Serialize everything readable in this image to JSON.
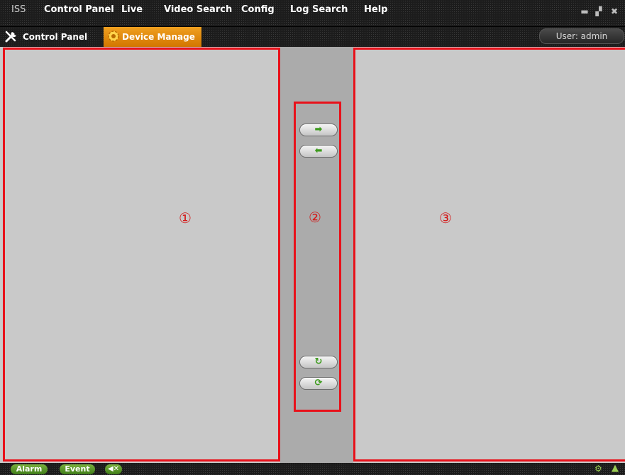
{
  "menu": {
    "brand": "ISS",
    "items": [
      "Control Panel",
      "Live",
      "Video Search",
      "Config",
      "Log Search",
      "Help"
    ]
  },
  "window_controls": {
    "minimize_icon": "minimize-icon",
    "restore_icon": "restore-icon",
    "close_icon": "close-icon"
  },
  "tabs": [
    {
      "label": "Control Panel",
      "icon": "tools-icon",
      "active": false
    },
    {
      "label": "Device Manage",
      "icon": "gear-icon",
      "active": true
    }
  ],
  "user": {
    "label": "User: admin"
  },
  "panels": {
    "left_marker": "①",
    "middle_marker": "②",
    "right_marker": "③"
  },
  "transfer_buttons": [
    {
      "icon": "arrow-right-icon",
      "glyph": "➡"
    },
    {
      "icon": "arrow-left-icon",
      "glyph": "⬅"
    },
    {
      "icon": "refresh-icon",
      "glyph": "↻"
    },
    {
      "icon": "sync-icon",
      "glyph": "⟳"
    }
  ],
  "status": {
    "alarm_label": "Alarm",
    "event_label": "Event",
    "mute_icon": "mute-icon",
    "right_icons": [
      "settings-icon",
      "up-arrow-icon"
    ]
  },
  "colors": {
    "highlight_border": "#e8111a",
    "active_tab": "#e38200",
    "accent_green": "#3d9a1d"
  }
}
